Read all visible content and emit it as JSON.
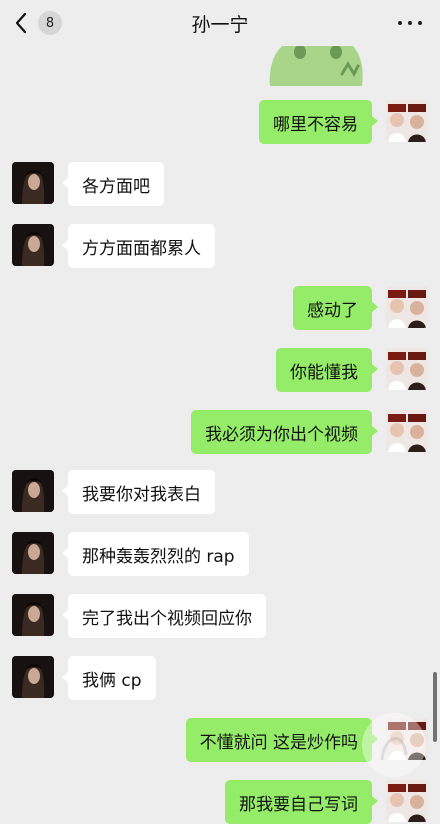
{
  "header": {
    "back_count": "8",
    "title": "孙一宁",
    "more_icon": "more-dots-icon",
    "back_icon": "chevron-left-icon"
  },
  "colors": {
    "background": "#ededed",
    "sent_bubble": "#95ec69",
    "received_bubble": "#ffffff"
  },
  "messages": [
    {
      "side": "right",
      "text": "哪里不容易"
    },
    {
      "side": "left",
      "text": "各方面吧"
    },
    {
      "side": "left",
      "text": "方方面面都累人"
    },
    {
      "side": "right",
      "text": "感动了"
    },
    {
      "side": "right",
      "text": "你能懂我"
    },
    {
      "side": "right",
      "text": "我必须为你出个视频"
    },
    {
      "side": "left",
      "text": "我要你对我表白"
    },
    {
      "side": "left",
      "text": "那种轰轰烈烈的 rap"
    },
    {
      "side": "left",
      "text": "完了我出个视频回应你"
    },
    {
      "side": "left",
      "text": "我俩 cp"
    },
    {
      "side": "right",
      "text": "不懂就问 这是炒作吗"
    },
    {
      "side": "right",
      "text": "那我要自己写词"
    }
  ]
}
